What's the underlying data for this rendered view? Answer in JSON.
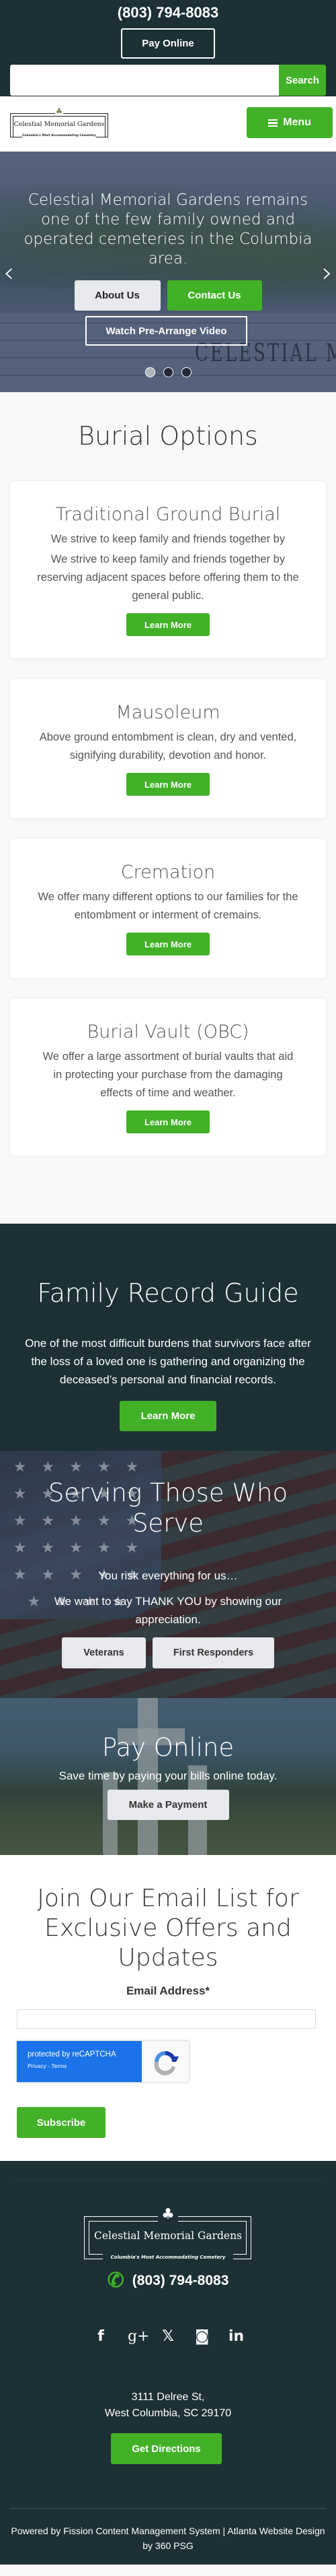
{
  "topbar": {
    "phone": "(803) 794-8083",
    "pay_online": "Pay Online",
    "search_placeholder": "",
    "search_value": "",
    "search_button": "Search"
  },
  "header": {
    "logo_name": "Celestial Memorial Gardens",
    "logo_tagline": "Columbia's Most Accommodating Cemetery",
    "menu_label": "Menu"
  },
  "hero": {
    "text": "Celestial Memorial Gardens remains one of the few family owned and operated cemeteries in the Columbia area.",
    "about_btn": "About Us",
    "contact_btn": "Contact Us",
    "video_btn": "Watch Pre-Arrange Video",
    "wall_text": "CELESTIAL MEMORIAL G",
    "slides_total": 3,
    "active_slide": 1,
    "prev_glyph": "‹",
    "next_glyph": "›"
  },
  "burial": {
    "title": "Burial Options",
    "cards": [
      {
        "title": "Traditional Ground Burial",
        "text": "We strive to keep family and friends together by reserving adjacent spaces before offering them to the general public.",
        "button": "Learn More"
      },
      {
        "title": "Mausoleum",
        "text": "Above ground entombment is clean, dry and vented, signifying durability, devotion and honor.",
        "button": "Learn More"
      },
      {
        "title": "Cremation",
        "text": "We offer many different options to our families for the entombment or interment of cremains.",
        "button": "Learn More"
      },
      {
        "title": "Burial Vault (OBC)",
        "text": "We offer a large assortment of burial vaults that aid in protecting your purchase from the damaging effects of time and weather.",
        "button": "Learn More"
      }
    ]
  },
  "family_record": {
    "title": "Family Record Guide",
    "text": "One of the most difficult burdens that survivors face after the loss of a loved one is gathering and organizing the deceased’s personal and financial records.",
    "button": "Learn More"
  },
  "serving": {
    "title": "Serving Those Who Serve",
    "line1": "You risk everything for us…",
    "line2": "We want to say THANK YOU by showing our appreciation.",
    "veterans_btn": "Veterans",
    "responders_btn": "First Responders"
  },
  "pay_online": {
    "title": "Pay Online",
    "text": "Save time by paying your bills online today.",
    "button": "Make a Payment"
  },
  "email_signup": {
    "title": "Join Our Email List for Exclusive Offers and Updates",
    "label": "Email Address*",
    "email_value": "",
    "recaptcha_text": "protected by reCAPTCHA",
    "recaptcha_links": "Privacy - Terms",
    "subscribe": "Subscribe"
  },
  "footer": {
    "logo_name": "Celestial Memorial Gardens",
    "logo_tagline": "Columbia's Most Accommodating Cemetery",
    "phone": "(803) 794-8083",
    "social": [
      {
        "name": "facebook",
        "glyph": "f"
      },
      {
        "name": "google-plus",
        "glyph": "g+"
      },
      {
        "name": "x-twitter",
        "glyph": "𝕏"
      },
      {
        "name": "instagram",
        "glyph": "◙"
      },
      {
        "name": "linkedin",
        "glyph": "in"
      }
    ],
    "address_line1": "3111 Delree St,",
    "address_line2": "West Columbia, SC 29170",
    "directions": "Get Directions",
    "credits": "Powered by Fission Content Management System | Atlanta Website Design by 360 PSG"
  },
  "colors": {
    "brand_dark": "#1c3036",
    "accent_green": "#42b128",
    "button_grey": "#e8e9ec",
    "recaptcha_blue": "#1a73e8"
  }
}
